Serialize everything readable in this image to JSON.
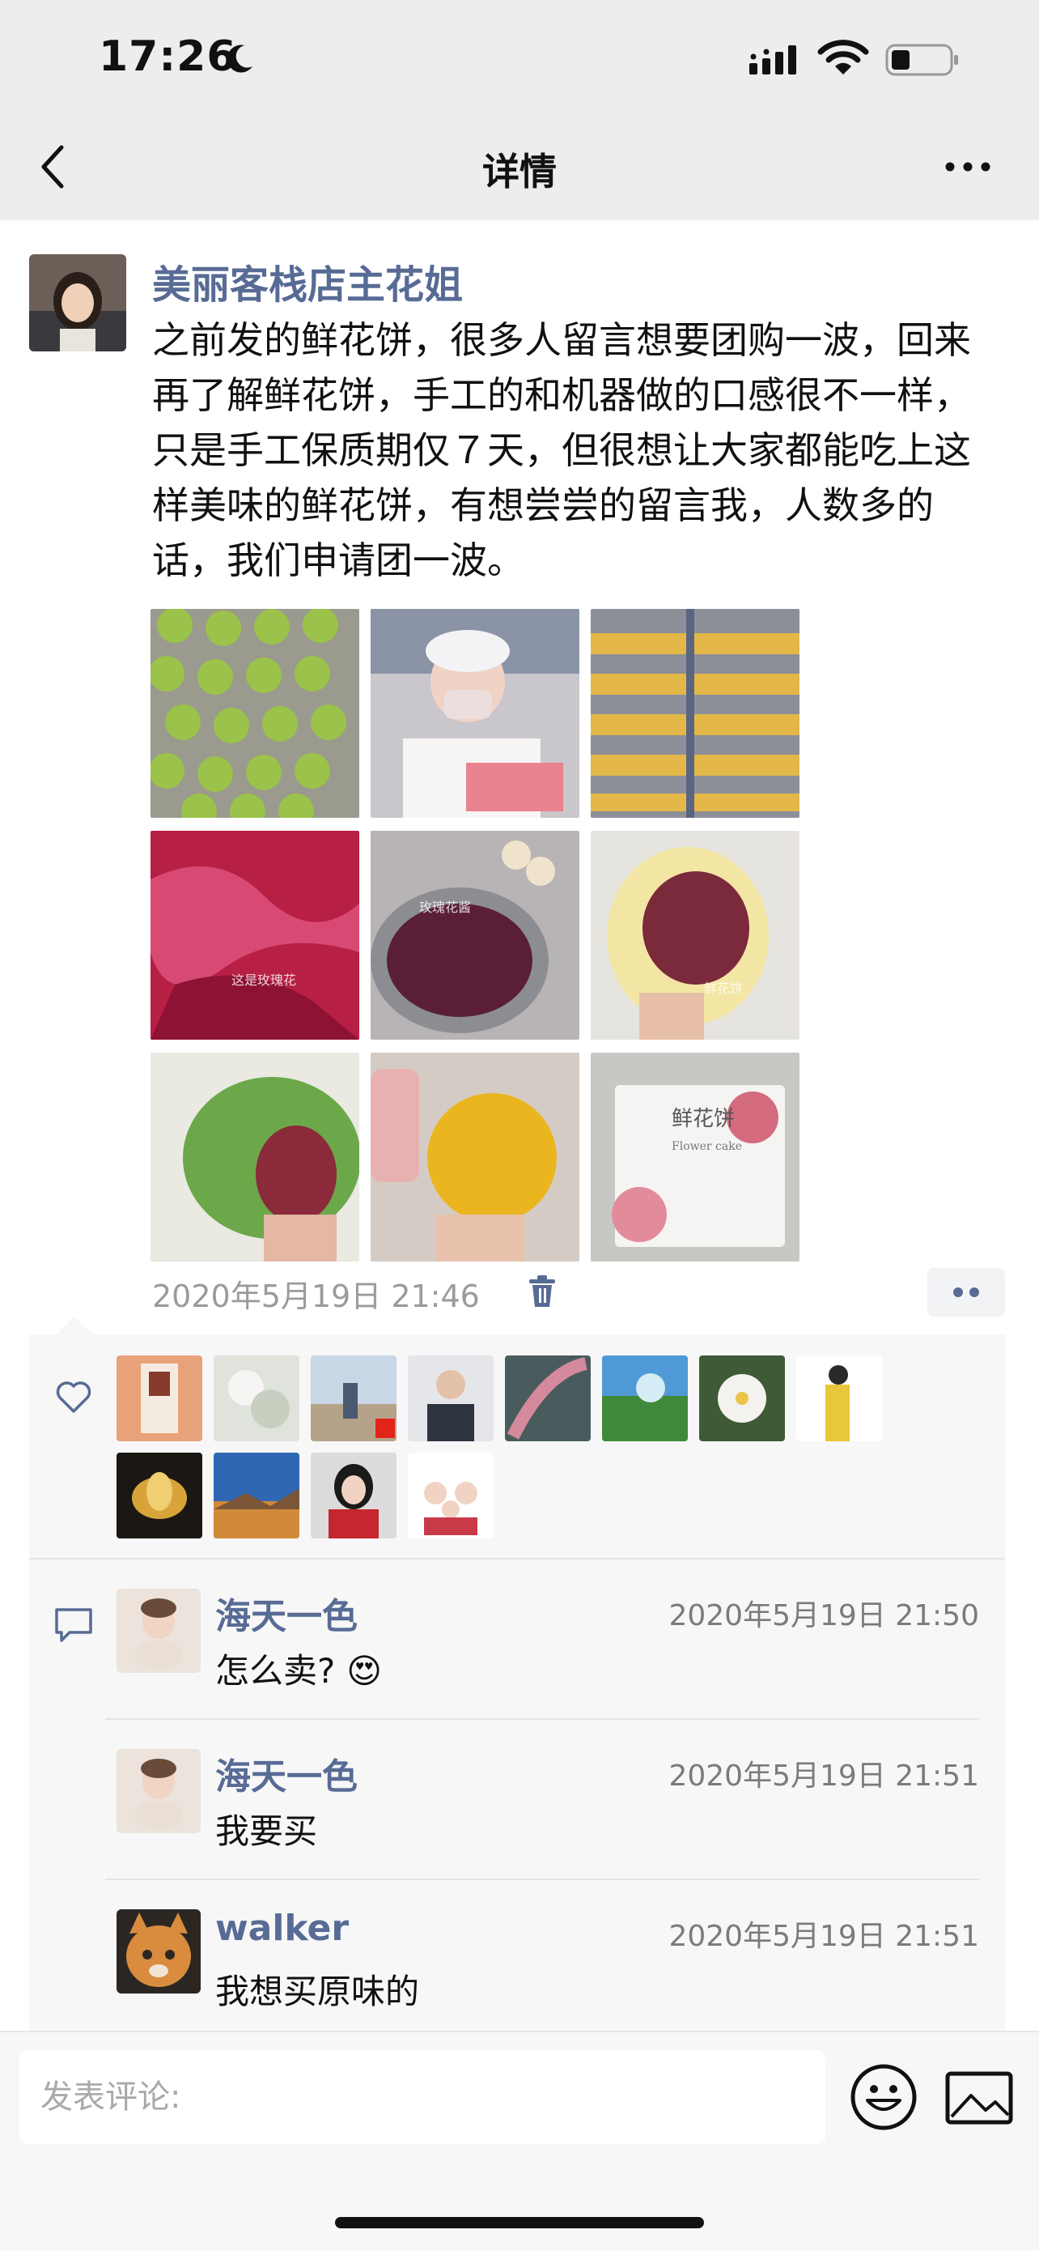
{
  "status_bar": {
    "time": "17:26"
  },
  "nav": {
    "title": "详情"
  },
  "post": {
    "author": "美丽客栈店主花姐",
    "text": "之前发的鲜花饼，很多人留言想要团购一波，回来再了解鲜花饼，手工的和机器做的口感很不一样，只是手工保质期仅７天，但很想让大家都能吃上这样美味的鲜花饼，有想尝尝的留言我，人数多的话，我们申请团一波。",
    "timestamp": "2020年5月19日 21:46",
    "photo_overlay_texts": [
      "这是玫瑰花",
      "玫瑰花酱",
      "鲜花饼",
      "鲜花饼",
      "Flower cake"
    ]
  },
  "likes": {
    "icon": "heart-icon",
    "count_shown": 12
  },
  "comments": [
    {
      "name": "海天一色",
      "time": "2020年5月19日 21:50",
      "text": "怎么卖?",
      "emoji": "😍"
    },
    {
      "name": "海天一色",
      "time": "2020年5月19日 21:51",
      "text": "我要买",
      "emoji": ""
    },
    {
      "name": "walker",
      "time": "2020年5月19日 21:51",
      "text": "我想买原味的",
      "emoji": ""
    }
  ],
  "composer": {
    "placeholder": "发表评论:"
  },
  "colors": {
    "link": "#576b95",
    "nav_bg": "#ededed",
    "panel_bg": "#f7f7f7"
  }
}
